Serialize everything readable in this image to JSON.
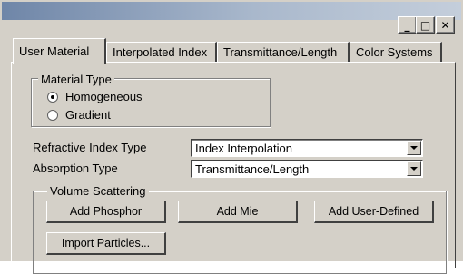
{
  "title_bar": {
    "buttons": [
      {
        "icon": "minimize-icon",
        "glyph": "_"
      },
      {
        "icon": "maximize-icon",
        "glyph": "□"
      },
      {
        "icon": "close-icon",
        "glyph": "✕"
      }
    ]
  },
  "tabs": [
    {
      "label": "User Material",
      "active": true
    },
    {
      "label": "Interpolated Index",
      "active": false
    },
    {
      "label": "Transmittance/Length",
      "active": false
    },
    {
      "label": "Color Systems",
      "active": false
    }
  ],
  "material_type": {
    "legend": "Material Type",
    "options": [
      {
        "label": "Homogeneous",
        "selected": true
      },
      {
        "label": "Gradient",
        "selected": false
      }
    ]
  },
  "refractive_index": {
    "label": "Refractive Index Type",
    "value": "Index Interpolation"
  },
  "absorption": {
    "label": "Absorption Type",
    "value": "Transmittance/Length"
  },
  "volume_scattering": {
    "legend": "Volume Scattering",
    "buttons": {
      "add_phosphor": "Add Phosphor",
      "add_mie": "Add Mie",
      "add_user_defined": "Add User-Defined",
      "import_particles": "Import Particles..."
    }
  }
}
